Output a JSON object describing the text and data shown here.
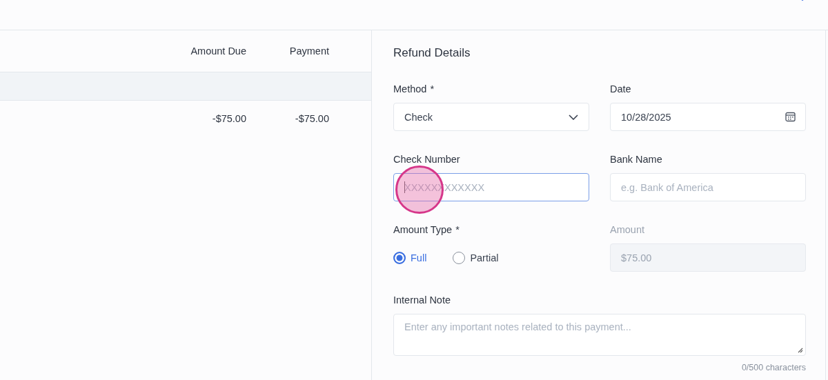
{
  "table": {
    "columns": [
      "Amount Due",
      "Payment"
    ],
    "rows": [
      {
        "amount_due": "-$75.00",
        "payment": "-$75.00"
      }
    ]
  },
  "refund_details": {
    "title": "Refund Details",
    "fields": [
      {
        "kind": "select",
        "label": "Method",
        "required_mark": "*",
        "value": "Check"
      },
      {
        "kind": "date",
        "label": "Date",
        "value": "10/28/2025"
      },
      {
        "kind": "text",
        "label": "Check Number",
        "disabled": false,
        "focused": true,
        "placeholder": "XXXXXXXXXXXX"
      },
      {
        "kind": "text",
        "label": "Bank Name",
        "disabled": false,
        "focused": false,
        "placeholder": "e.g. Bank of America"
      },
      {
        "kind": "radio",
        "label": "Amount Type",
        "required_mark": "*",
        "options": [
          {
            "label": "Full",
            "selected": true
          },
          {
            "label": "Partial",
            "selected": false
          }
        ]
      },
      {
        "kind": "text",
        "label": "Amount",
        "disabled": true,
        "focused": false,
        "value": "$75.00"
      },
      {
        "kind": "textarea",
        "label": "Internal Note",
        "placeholder": "Enter any important notes related to this payment...",
        "counter": "0/500 characters"
      }
    ]
  }
}
